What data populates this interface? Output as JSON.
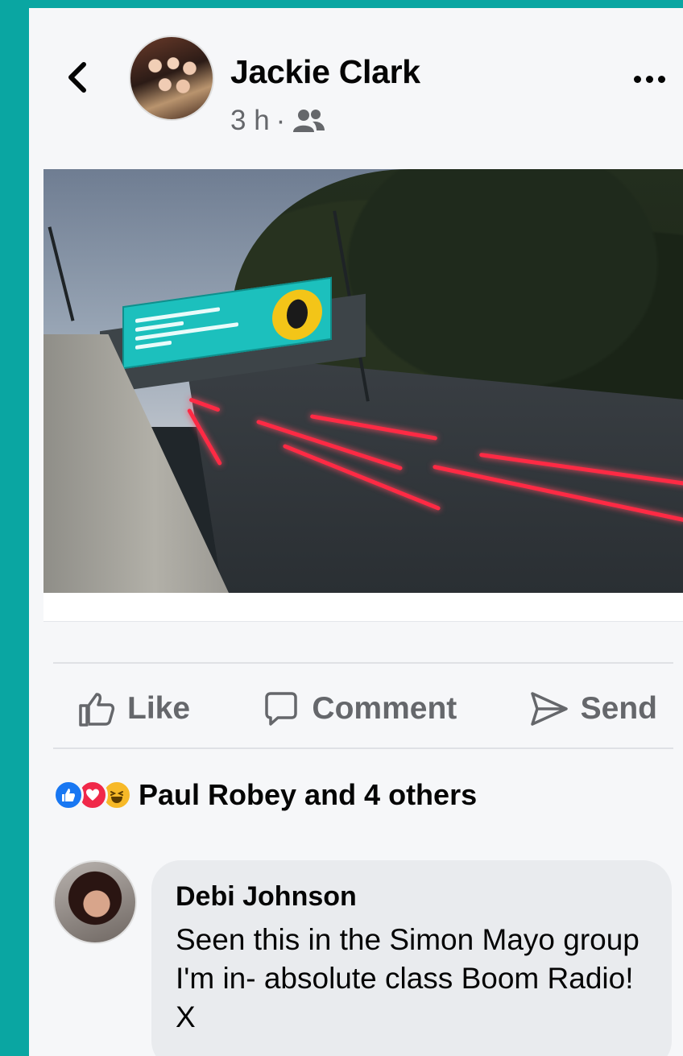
{
  "post": {
    "author": "Jackie Clark",
    "time": "3 h",
    "separator": "·",
    "audience_icon": "friends-icon"
  },
  "actions": {
    "like": "Like",
    "comment": "Comment",
    "send": "Send"
  },
  "reactions": {
    "icons": [
      "like-icon",
      "love-icon",
      "haha-icon"
    ],
    "summary": "Paul Robey and 4 others"
  },
  "comment": {
    "author": "Debi Johnson",
    "text": "Seen this in the Simon Mayo group I'm in- absolute class Boom Radio! X"
  },
  "colors": {
    "frame": "#0aa6a2",
    "like_blue": "#1877f2",
    "love_red": "#f02849",
    "haha_yellow": "#f7b928",
    "secondary_text": "#65676b"
  }
}
